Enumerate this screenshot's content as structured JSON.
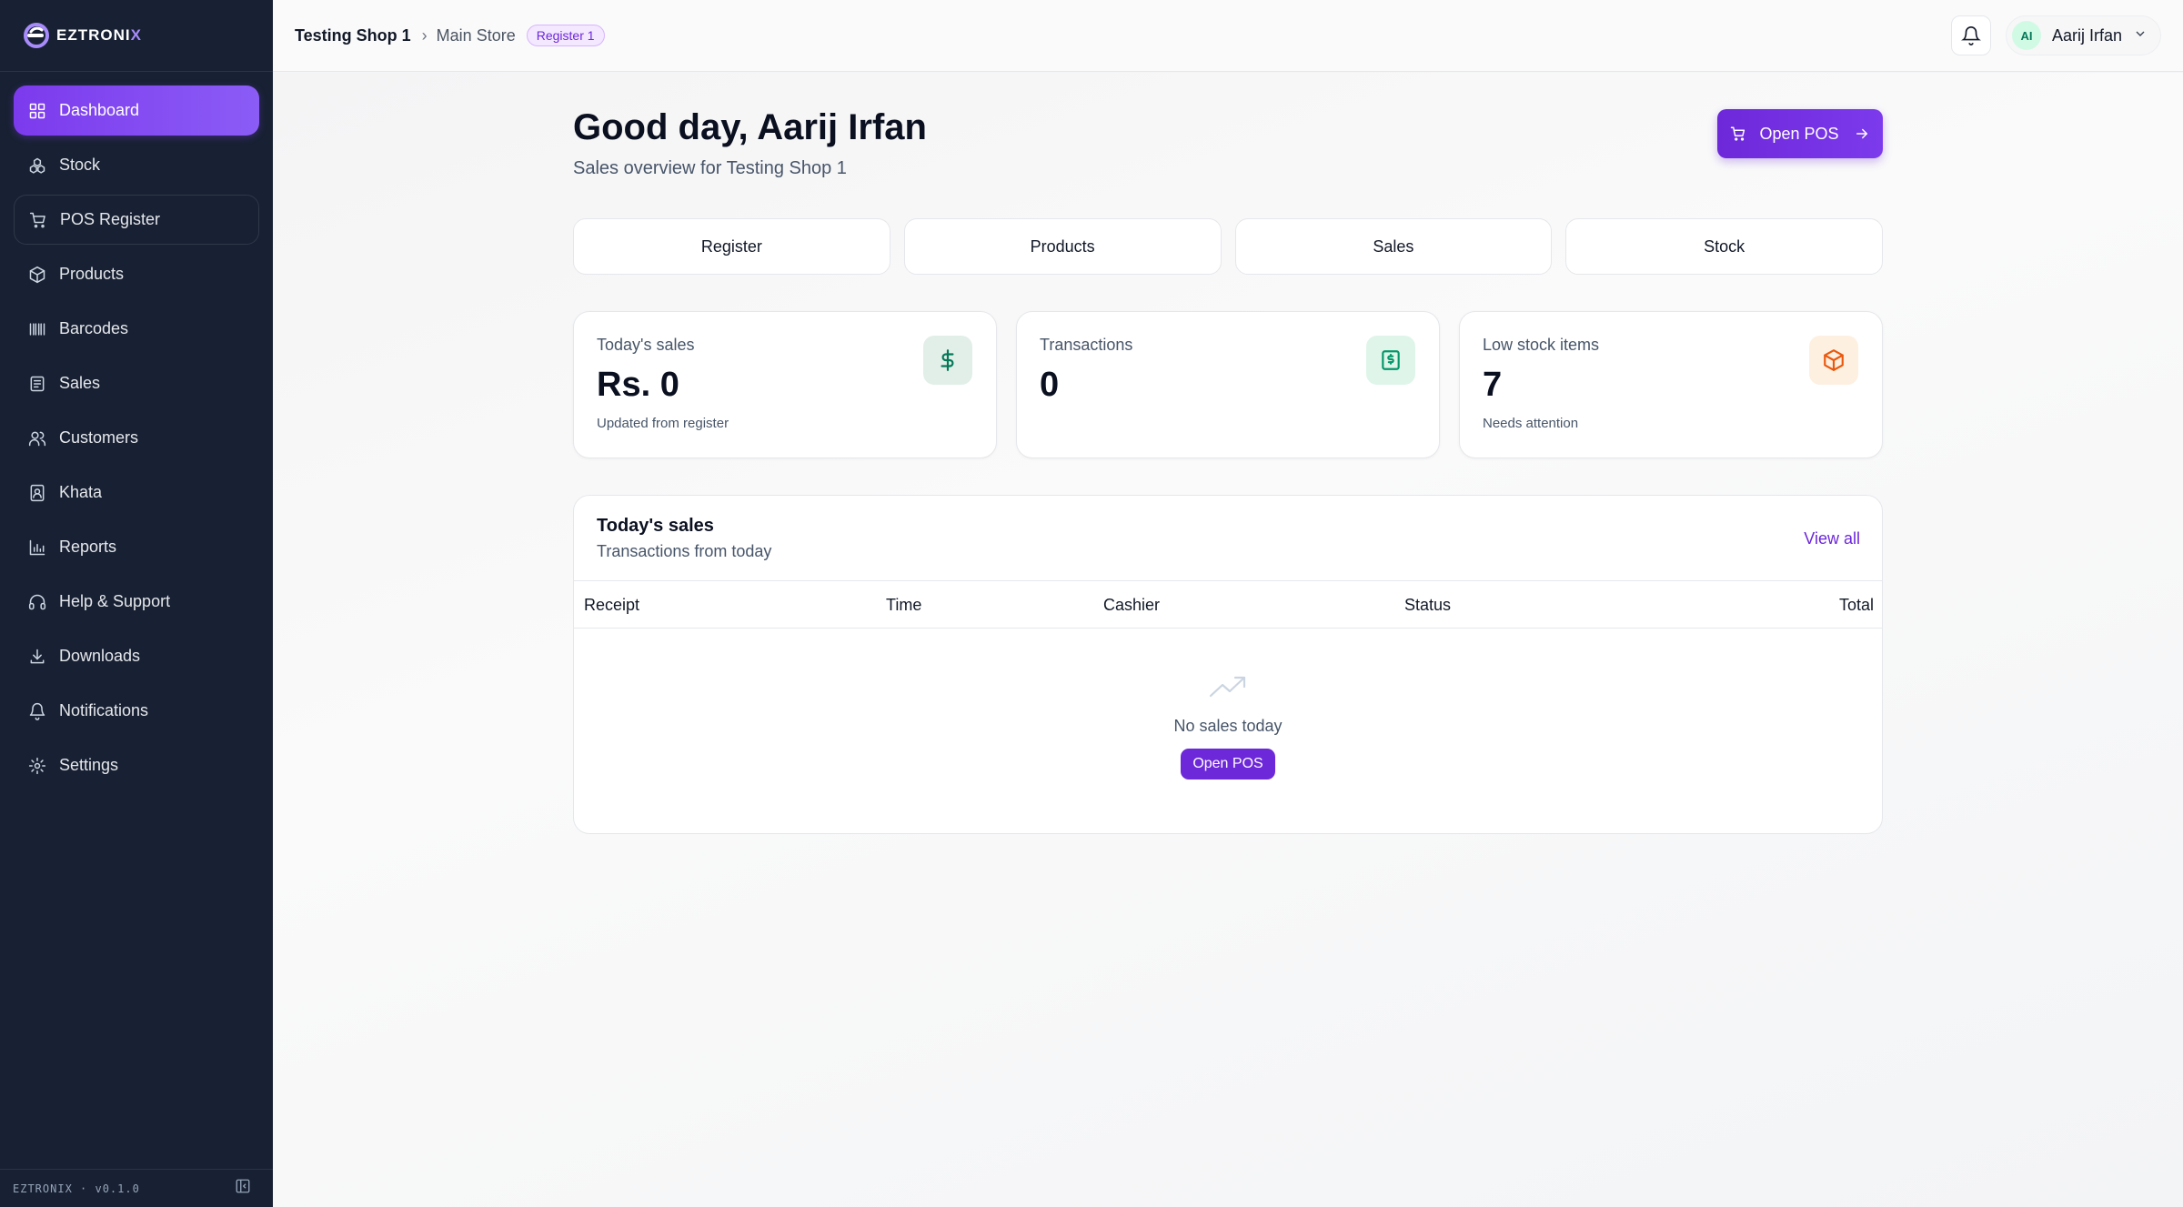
{
  "brand": {
    "name_main": "EZTRONI",
    "name_accent": "X",
    "version": "EZTRONIX · v0.1.0"
  },
  "sidebar": {
    "items": [
      {
        "label": "Dashboard",
        "icon": "grid-icon"
      },
      {
        "label": "Stock",
        "icon": "boxes-icon"
      },
      {
        "label": "POS Register",
        "icon": "cart-icon"
      },
      {
        "label": "Products",
        "icon": "package-icon"
      },
      {
        "label": "Barcodes",
        "icon": "barcode-icon"
      },
      {
        "label": "Sales",
        "icon": "receipt-icon"
      },
      {
        "label": "Customers",
        "icon": "users-icon"
      },
      {
        "label": "Khata",
        "icon": "ledger-icon"
      },
      {
        "label": "Reports",
        "icon": "bar-chart-icon"
      },
      {
        "label": "Help & Support",
        "icon": "headset-icon"
      },
      {
        "label": "Downloads",
        "icon": "download-icon"
      },
      {
        "label": "Notifications",
        "icon": "bell-icon"
      },
      {
        "label": "Settings",
        "icon": "gear-icon"
      }
    ],
    "active": "Dashboard"
  },
  "topbar": {
    "shop": "Testing Shop 1",
    "store": "Main Store",
    "register_badge": "Register 1",
    "user_initials": "AI",
    "user_name": "Aarij Irfan"
  },
  "main": {
    "greeting": "Good day, Aarij Irfan",
    "subtitle": "Sales overview for Testing Shop 1",
    "open_pos": "Open POS",
    "quick_tabs": [
      "Register",
      "Products",
      "Sales",
      "Stock"
    ],
    "stats": [
      {
        "label": "Today's sales",
        "value": "Rs. 0",
        "note": "Updated from register",
        "icon": "dollar-icon"
      },
      {
        "label": "Transactions",
        "value": "0",
        "note": "",
        "icon": "receipt-icon"
      },
      {
        "label": "Low stock items",
        "value": "7",
        "note": "Needs attention",
        "icon": "package-icon"
      }
    ],
    "sales_table": {
      "title": "Today's sales",
      "subtitle": "Transactions from today",
      "view_all": "View all",
      "columns": [
        "Receipt",
        "Time",
        "Cashier",
        "Status",
        "Total"
      ],
      "rows": [],
      "empty_text": "No sales today",
      "empty_button": "Open POS"
    }
  },
  "colors": {
    "sidebar_bg": "#182133",
    "accent": "#6d28d9",
    "accent_light": "#8b5cf6"
  }
}
